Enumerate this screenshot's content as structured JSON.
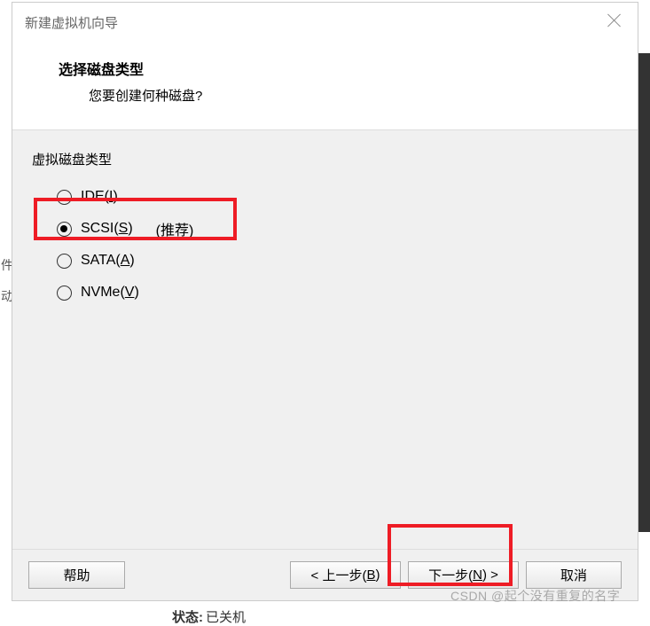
{
  "window": {
    "title": "新建虚拟机向导",
    "close_name": "close"
  },
  "header": {
    "title": "选择磁盘类型",
    "subtitle": "您要创建何种磁盘?"
  },
  "group": {
    "label": "虚拟磁盘类型",
    "options": [
      {
        "main": "IDE(",
        "mnemonic": "I",
        "tail": ")",
        "selected": false,
        "suffix": ""
      },
      {
        "main": "SCSI(",
        "mnemonic": "S",
        "tail": ")",
        "selected": true,
        "suffix": "(推荐)"
      },
      {
        "main": "SATA(",
        "mnemonic": "A",
        "tail": ")",
        "selected": false,
        "suffix": ""
      },
      {
        "main": "NVMe(",
        "mnemonic": "V",
        "tail": ")",
        "selected": false,
        "suffix": ""
      }
    ]
  },
  "buttons": {
    "help": "帮助",
    "back_pre": "< 上一步(",
    "back_mn": "B",
    "back_post": ")",
    "next_pre": "下一步(",
    "next_mn": "N",
    "next_post": ") >",
    "cancel": "取消"
  },
  "background_chars": {
    "c1": "件",
    "c2": "动"
  },
  "watermark": "CSDN @起个没有重复的名字",
  "footer_fragment": {
    "label": "状态:",
    "value": "已关机"
  },
  "highlight_color": "#ee1c25"
}
